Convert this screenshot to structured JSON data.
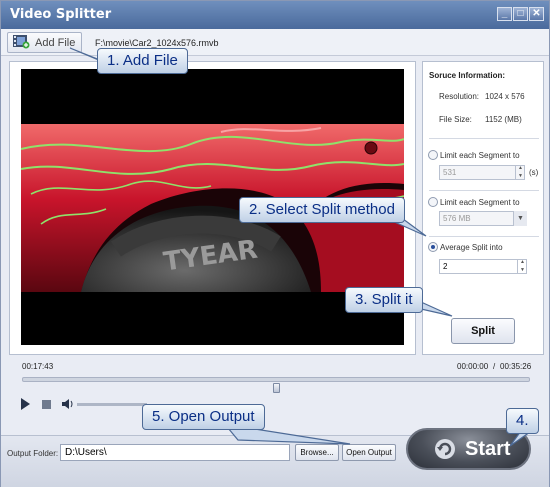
{
  "window": {
    "title": "Video Splitter"
  },
  "toolbar": {
    "add_file_label": "Add File",
    "file_path": "F:\\movie\\Car2_1024x576.rmvb"
  },
  "source_info": {
    "heading": "Soruce Information:",
    "resolution_label": "Resolution:",
    "resolution_value": "1024 x 576",
    "file_size_label": "File Size:",
    "file_size_value": "1152 (MB)"
  },
  "split_options": {
    "option1_label": "Limit each Segment to",
    "option1_value": "531",
    "option1_unit": "(s)",
    "option2_label": "Limit each Segment to",
    "option2_value": "576 MB",
    "option3_label": "Average Split into",
    "option3_value": "2",
    "selected": "Average Split into",
    "split_button": "Split"
  },
  "player": {
    "current_time": "00:17:43",
    "range_start": "00:00:00",
    "separator": "/",
    "range_end": "00:35:26",
    "position_fraction": 0.5
  },
  "output": {
    "label": "Output Folder:",
    "path": "D:\\Users\\",
    "browse_label": "Browse...",
    "open_output_label": "Open Output",
    "start_label": "Start"
  },
  "callouts": {
    "c1": "1. Add File",
    "c2": "2. Select Split method",
    "c3": "3. Split it",
    "c4": "4.",
    "c5": "5. Open Output"
  },
  "colors": {
    "title_bar": "#4a6a9c",
    "callout_text": "#0b2f86"
  }
}
